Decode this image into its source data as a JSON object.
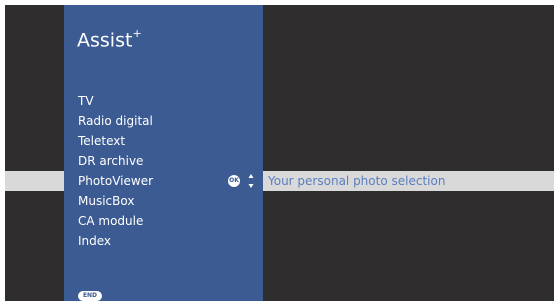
{
  "title": {
    "text": "Assist",
    "sup": "+"
  },
  "menu": {
    "items": [
      {
        "label": "TV"
      },
      {
        "label": "Radio digital"
      },
      {
        "label": "Teletext"
      },
      {
        "label": "DR archive"
      },
      {
        "label": "PhotoViewer",
        "selected": true,
        "description": "Your personal photo selection"
      },
      {
        "label": "MusicBox"
      },
      {
        "label": "CA module"
      },
      {
        "label": "Index"
      }
    ]
  },
  "buttons": {
    "ok_label": "OK",
    "end_label": "END"
  },
  "colors": {
    "panel": "#3b5b92",
    "background": "#2e2c2c",
    "highlight": "#d9d9d9",
    "description": "#5b7fbf"
  },
  "icons": {
    "ok": "ok-button-icon",
    "nav": "up-down-arrows-icon",
    "end": "end-button-icon"
  }
}
